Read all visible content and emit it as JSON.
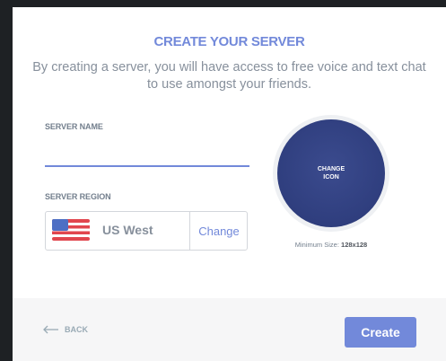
{
  "modal": {
    "title": "CREATE YOUR SERVER",
    "subtitle": "By creating a server, you will have access to free voice and text chat to use amongst your friends."
  },
  "server_name": {
    "label": "SERVER NAME",
    "value": ""
  },
  "server_region": {
    "label": "SERVER REGION",
    "flag_icon": "us-flag-icon",
    "value": "US West",
    "change_label": "Change"
  },
  "server_icon": {
    "label": "CHANGE\nICON",
    "min_size_label": "Minimum Size:",
    "min_size_value": "128x128"
  },
  "footer": {
    "back_label": "BACK",
    "create_label": "Create"
  },
  "colors": {
    "accent": "#7289da",
    "backdrop": "#1e2124",
    "icon_circle": "#2f3e7e",
    "footer_bg": "#f6f6f7"
  }
}
